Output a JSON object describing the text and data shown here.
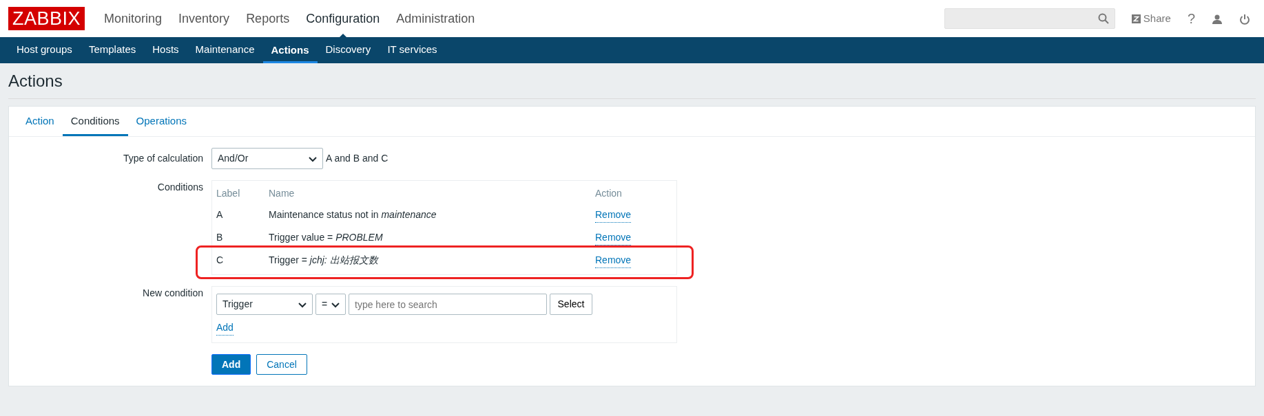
{
  "header": {
    "logo": "ZABBIX",
    "menu": [
      {
        "label": "Monitoring",
        "selected": false
      },
      {
        "label": "Inventory",
        "selected": false
      },
      {
        "label": "Reports",
        "selected": false
      },
      {
        "label": "Configuration",
        "selected": true
      },
      {
        "label": "Administration",
        "selected": false
      }
    ],
    "share": "Share",
    "help": "?"
  },
  "submenu": [
    {
      "label": "Host groups",
      "selected": false
    },
    {
      "label": "Templates",
      "selected": false
    },
    {
      "label": "Hosts",
      "selected": false
    },
    {
      "label": "Maintenance",
      "selected": false
    },
    {
      "label": "Actions",
      "selected": true
    },
    {
      "label": "Discovery",
      "selected": false
    },
    {
      "label": "IT services",
      "selected": false
    }
  ],
  "page_title": "Actions",
  "tabs": [
    {
      "label": "Action",
      "selected": false
    },
    {
      "label": "Conditions",
      "selected": true
    },
    {
      "label": "Operations",
      "selected": false
    }
  ],
  "type_of_calculation": {
    "label": "Type of calculation",
    "value": "And/Or",
    "formula": "A and B and C"
  },
  "conditions": {
    "label": "Conditions",
    "columns": [
      "Label",
      "Name",
      "Action"
    ],
    "rows": [
      {
        "label": "A",
        "name": "Maintenance status not in *maintenance*",
        "action": "Remove",
        "highlighted": false
      },
      {
        "label": "B",
        "name": "Trigger value = *PROBLEM*",
        "action": "Remove",
        "highlighted": false
      },
      {
        "label": "C",
        "name": "Trigger = *jchj: 出站报文数*",
        "action": "Remove",
        "highlighted": true
      }
    ]
  },
  "new_condition": {
    "label": "New condition",
    "type": "Trigger",
    "operator": "=",
    "placeholder": "type here to search",
    "select": "Select",
    "add": "Add"
  },
  "buttons": [
    {
      "label": "Add",
      "kind": "primary"
    },
    {
      "label": "Cancel",
      "kind": "secondary"
    }
  ]
}
